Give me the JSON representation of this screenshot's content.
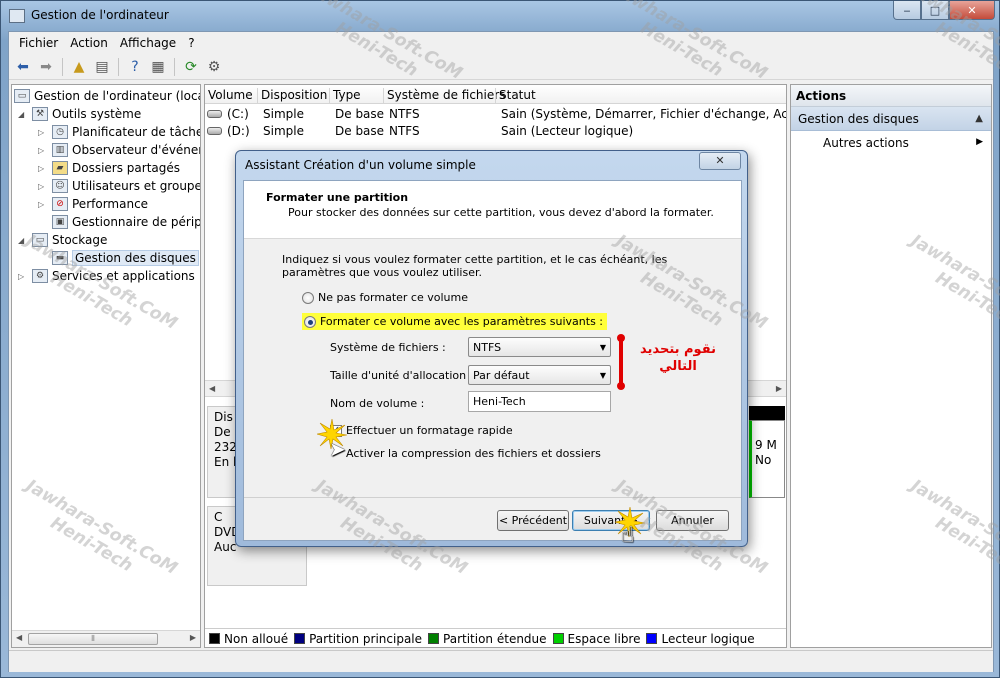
{
  "window": {
    "title": "Gestion de l'ordinateur",
    "min": "‒",
    "max": "□",
    "close": "✕"
  },
  "menu": [
    "Fichier",
    "Action",
    "Affichage",
    "?"
  ],
  "tree": [
    {
      "label": "Gestion de l'ordinateur (local)",
      "level": 0,
      "exp": ""
    },
    {
      "label": "Outils système",
      "level": 1,
      "exp": "◢"
    },
    {
      "label": "Planificateur de tâches",
      "level": 2,
      "exp": "▷"
    },
    {
      "label": "Observateur d'événeme",
      "level": 2,
      "exp": "▷"
    },
    {
      "label": "Dossiers partagés",
      "level": 2,
      "exp": "▷"
    },
    {
      "label": "Utilisateurs et groupes l",
      "level": 2,
      "exp": "▷"
    },
    {
      "label": "Performance",
      "level": 2,
      "exp": "▷"
    },
    {
      "label": "Gestionnaire de périphé",
      "level": 2,
      "exp": ""
    },
    {
      "label": "Stockage",
      "level": 1,
      "exp": "◢"
    },
    {
      "label": "Gestion des disques",
      "level": 2,
      "exp": ""
    },
    {
      "label": "Services et applications",
      "level": 1,
      "exp": "▷"
    }
  ],
  "volume_table": {
    "headers": [
      "Volume",
      "Disposition",
      "Type",
      "Système de fichiers",
      "Statut"
    ],
    "rows": [
      [
        "(C:)",
        "Simple",
        "De base",
        "NTFS",
        "Sain (Système, Démarrer, Fichier d'échange, Actif, Vid"
      ],
      [
        "(D:)",
        "Simple",
        "De base",
        "NTFS",
        "Sain (Lecteur logique)"
      ]
    ]
  },
  "disk_area": {
    "disk0_lines": [
      "Dis",
      "De b",
      "232,",
      "En li"
    ],
    "cdrom_lines": [
      "C",
      "DVD",
      "",
      "Auc"
    ],
    "right_lines": [
      "9 M",
      "No"
    ]
  },
  "legend": [
    {
      "label": "Non alloué",
      "color": "#000000"
    },
    {
      "label": "Partition principale",
      "color": "#000080"
    },
    {
      "label": "Partition étendue",
      "color": "#008000"
    },
    {
      "label": "Espace libre",
      "color": "#00d000"
    },
    {
      "label": "Lecteur logique",
      "color": "#0000ff"
    }
  ],
  "actions": {
    "title": "Actions",
    "section": "Gestion des disques",
    "item": "Autres actions"
  },
  "dialog": {
    "title": "Assistant Création d'un volume simple",
    "close": "✕",
    "heading": "Formater une partition",
    "subheading": "Pour stocker des données sur cette partition, vous devez d'abord la formater.",
    "intro": "Indiquez si vous voulez formater cette partition, et le cas échéant, les paramètres que vous voulez utiliser.",
    "radio_no_format": "Ne pas formater ce volume",
    "radio_format": "Formater ce volume avec les paramètres suivants :",
    "fs_label": "Système de fichiers :",
    "fs_value": "NTFS",
    "alloc_label": "Taille d'unité d'allocation :",
    "alloc_value": "Par défaut",
    "volname_label": "Nom de volume :",
    "volname_value": "Heni-Tech",
    "quick_format": "Effectuer un formatage rapide",
    "compression": "Activer la compression des fichiers et dossiers",
    "btn_prev": "< Précédent",
    "btn_next": "Suivant >",
    "btn_cancel": "Annuler"
  },
  "annotation": {
    "line1": "نقوم بتحديد",
    "line2": "التالي"
  },
  "watermark": {
    "line1": "Jawhara-Soft.CoM",
    "line2": "Heni-Tech"
  }
}
